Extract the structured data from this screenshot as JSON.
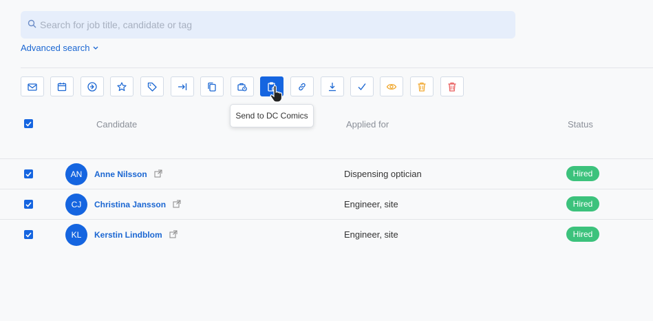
{
  "search": {
    "placeholder": "Search for job title, candidate or tag",
    "value": ""
  },
  "advanced_search": {
    "label": "Advanced search"
  },
  "toolbar": {
    "buttons": [
      {
        "icon": "mail-icon",
        "label": ""
      },
      {
        "icon": "calendar-icon",
        "label": ""
      },
      {
        "icon": "move-stage-icon",
        "label": ""
      },
      {
        "icon": "star-icon",
        "label": ""
      },
      {
        "icon": "tag-icon",
        "label": ""
      },
      {
        "icon": "move-to-end-icon",
        "label": ""
      },
      {
        "icon": "copy-icon",
        "label": ""
      },
      {
        "icon": "briefcase-icon",
        "label": ""
      },
      {
        "icon": "clipboard-send-icon",
        "label": "Send to DC Comics",
        "active": true
      },
      {
        "icon": "link-icon",
        "label": ""
      },
      {
        "icon": "download-icon",
        "label": ""
      },
      {
        "icon": "check-icon",
        "label": ""
      },
      {
        "icon": "eye-icon",
        "label": ""
      },
      {
        "icon": "trash-yellow-icon",
        "label": ""
      },
      {
        "icon": "trash-red-icon",
        "label": ""
      }
    ],
    "tooltip": "Send to DC Comics"
  },
  "table": {
    "headers": {
      "candidate": "Candidate",
      "applied_for": "Applied for",
      "status": "Status"
    },
    "rows": [
      {
        "initials": "AN",
        "name": "Anne Nilsson",
        "job": "Dispensing optician",
        "status": "Hired",
        "checked": true
      },
      {
        "initials": "CJ",
        "name": "Christina Jansson",
        "job": "Engineer, site",
        "status": "Hired",
        "checked": true
      },
      {
        "initials": "KL",
        "name": "Kerstin Lindblom",
        "job": "Engineer, site",
        "status": "Hired",
        "checked": true
      }
    ]
  },
  "colors": {
    "accent": "#1565e0",
    "hired": "#3cc27c",
    "warning": "#f0a830",
    "danger": "#e85a5a",
    "search_bg": "#e6eefb"
  }
}
